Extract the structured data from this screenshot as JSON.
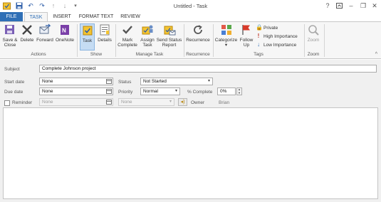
{
  "window": {
    "title": "Untitled - Task",
    "qat": [
      "outlook-task-icon",
      "save-icon",
      "undo-icon",
      "redo-icon",
      "up-arrow-icon",
      "down-arrow-icon",
      "customize-qat-icon"
    ],
    "controls": [
      "help-icon",
      "ribbon-display-icon",
      "minimize-icon",
      "restore-icon",
      "close-icon"
    ]
  },
  "tabs": [
    "FILE",
    "TASK",
    "INSERT",
    "FORMAT TEXT",
    "REVIEW"
  ],
  "active_tab": "TASK",
  "ribbon": {
    "actions": {
      "label": "Actions",
      "save_close": "Save &",
      "save_close2": "Close",
      "delete": "Delete",
      "forward": "Forward",
      "onenote": "OneNote"
    },
    "show": {
      "label": "Show",
      "task": "Task",
      "details": "Details"
    },
    "manage": {
      "label": "Manage Task",
      "mark_complete1": "Mark",
      "mark_complete2": "Complete",
      "assign1": "Assign",
      "assign2": "Task",
      "send_status1": "Send Status",
      "send_status2": "Report"
    },
    "recurrence": {
      "label": "Recurrence",
      "button": "Recurrence"
    },
    "tags": {
      "label": "Tags",
      "categorize1": "Categorize",
      "follow_up1": "Follow",
      "follow_up2": "Up",
      "private": "Private",
      "high": "High Importance",
      "low": "Low Importance"
    },
    "zoom": {
      "label": "Zoom",
      "button": "Zoom"
    }
  },
  "colors": {
    "accent": "#2f6fb6",
    "selected_bg": "#c5dcf3",
    "high_importance": "#c0392b",
    "low_importance": "#2e6bb5"
  },
  "form": {
    "subject_label": "Subject",
    "subject_value": "Complete Johnson project",
    "start_label": "Start date",
    "start_value": "None",
    "due_label": "Due date",
    "due_value": "None",
    "status_label": "Status",
    "status_value": "Not Started",
    "priority_label": "Priority",
    "priority_value": "Normal",
    "complete_label": "% Complete",
    "complete_value": "0%",
    "reminder_label": "Reminder",
    "reminder_date": "None",
    "reminder_time": "None",
    "owner_label": "Owner",
    "owner_value": "Brian",
    "body_text": ""
  }
}
